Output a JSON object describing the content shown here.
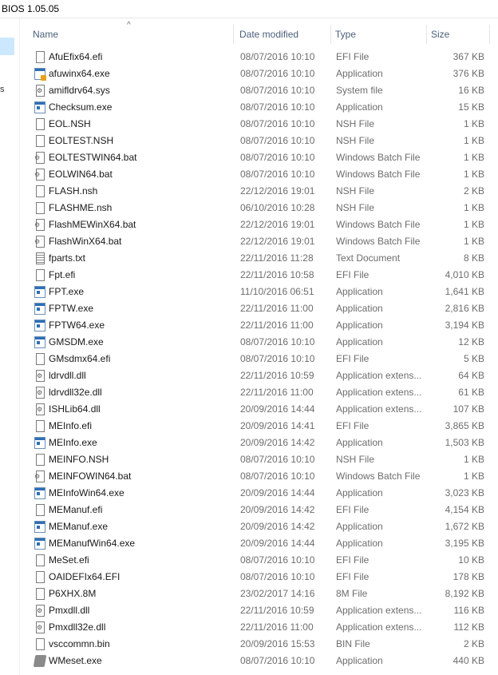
{
  "window": {
    "title": "BIOS 1.05.05"
  },
  "nav": {
    "partial_label": "s"
  },
  "columns": {
    "name": "Name",
    "date": "Date modified",
    "type": "Type",
    "size": "Size",
    "sort_arrow": "^"
  },
  "files": [
    {
      "name": "AfuEfix64.efi",
      "date": "08/07/2016 10:10",
      "type": "EFI File",
      "size": "367 KB",
      "icon": "file-icon"
    },
    {
      "name": "afuwinx64.exe",
      "date": "08/07/2016 10:10",
      "type": "Application",
      "size": "376 KB",
      "icon": "app-shield-icon"
    },
    {
      "name": "amifldrv64.sys",
      "date": "08/07/2016 10:10",
      "type": "System file",
      "size": "16 KB",
      "icon": "system-file-icon"
    },
    {
      "name": "Checksum.exe",
      "date": "08/07/2016 10:10",
      "type": "Application",
      "size": "15 KB",
      "icon": "app-icon"
    },
    {
      "name": "EOL.NSH",
      "date": "08/07/2016 10:10",
      "type": "NSH File",
      "size": "1 KB",
      "icon": "file-icon"
    },
    {
      "name": "EOLTEST.NSH",
      "date": "08/07/2016 10:10",
      "type": "NSH File",
      "size": "1 KB",
      "icon": "file-icon"
    },
    {
      "name": "EOLTESTWIN64.bat",
      "date": "08/07/2016 10:10",
      "type": "Windows Batch File",
      "size": "1 KB",
      "icon": "batch-file-icon"
    },
    {
      "name": "EOLWIN64.bat",
      "date": "08/07/2016 10:10",
      "type": "Windows Batch File",
      "size": "1 KB",
      "icon": "batch-file-icon"
    },
    {
      "name": "FLASH.nsh",
      "date": "22/12/2016 19:01",
      "type": "NSH File",
      "size": "2 KB",
      "icon": "file-icon"
    },
    {
      "name": "FLASHME.nsh",
      "date": "06/10/2016 10:28",
      "type": "NSH File",
      "size": "1 KB",
      "icon": "file-icon"
    },
    {
      "name": "FlashMEWinX64.bat",
      "date": "22/12/2016 19:01",
      "type": "Windows Batch File",
      "size": "1 KB",
      "icon": "batch-file-icon"
    },
    {
      "name": "FlashWinX64.bat",
      "date": "22/12/2016 19:01",
      "type": "Windows Batch File",
      "size": "1 KB",
      "icon": "batch-file-icon"
    },
    {
      "name": "fparts.txt",
      "date": "22/11/2016 11:28",
      "type": "Text Document",
      "size": "8 KB",
      "icon": "text-file-icon"
    },
    {
      "name": "Fpt.efi",
      "date": "22/11/2016 10:58",
      "type": "EFI File",
      "size": "4,010 KB",
      "icon": "file-icon"
    },
    {
      "name": "FPT.exe",
      "date": "11/10/2016 06:51",
      "type": "Application",
      "size": "1,641 KB",
      "icon": "app-icon"
    },
    {
      "name": "FPTW.exe",
      "date": "22/11/2016 11:00",
      "type": "Application",
      "size": "2,816 KB",
      "icon": "app-icon"
    },
    {
      "name": "FPTW64.exe",
      "date": "22/11/2016 11:00",
      "type": "Application",
      "size": "3,194 KB",
      "icon": "app-icon"
    },
    {
      "name": "GMSDM.exe",
      "date": "08/07/2016 10:10",
      "type": "Application",
      "size": "12 KB",
      "icon": "app-icon"
    },
    {
      "name": "GMsdmx64.efi",
      "date": "08/07/2016 10:10",
      "type": "EFI File",
      "size": "5 KB",
      "icon": "file-icon"
    },
    {
      "name": "ldrvdll.dll",
      "date": "22/11/2016 10:59",
      "type": "Application extens...",
      "size": "64 KB",
      "icon": "system-file-icon"
    },
    {
      "name": "ldrvdll32e.dll",
      "date": "22/11/2016 11:00",
      "type": "Application extens...",
      "size": "61 KB",
      "icon": "system-file-icon"
    },
    {
      "name": "ISHLib64.dll",
      "date": "20/09/2016 14:44",
      "type": "Application extens...",
      "size": "107 KB",
      "icon": "system-file-icon"
    },
    {
      "name": "MEInfo.efi",
      "date": "20/09/2016 14:41",
      "type": "EFI File",
      "size": "3,865 KB",
      "icon": "file-icon"
    },
    {
      "name": "MEInfo.exe",
      "date": "20/09/2016 14:42",
      "type": "Application",
      "size": "1,503 KB",
      "icon": "app-icon"
    },
    {
      "name": "MEINFO.NSH",
      "date": "08/07/2016 10:10",
      "type": "NSH File",
      "size": "1 KB",
      "icon": "file-icon"
    },
    {
      "name": "MEINFOWIN64.bat",
      "date": "08/07/2016 10:10",
      "type": "Windows Batch File",
      "size": "1 KB",
      "icon": "batch-file-icon"
    },
    {
      "name": "MEInfoWin64.exe",
      "date": "20/09/2016 14:44",
      "type": "Application",
      "size": "3,023 KB",
      "icon": "app-icon"
    },
    {
      "name": "MEManuf.efi",
      "date": "20/09/2016 14:42",
      "type": "EFI File",
      "size": "4,154 KB",
      "icon": "file-icon"
    },
    {
      "name": "MEManuf.exe",
      "date": "20/09/2016 14:42",
      "type": "Application",
      "size": "1,672 KB",
      "icon": "app-icon"
    },
    {
      "name": "MEManufWin64.exe",
      "date": "20/09/2016 14:44",
      "type": "Application",
      "size": "3,195 KB",
      "icon": "app-icon"
    },
    {
      "name": "MeSet.efi",
      "date": "08/07/2016 10:10",
      "type": "EFI File",
      "size": "10 KB",
      "icon": "file-icon"
    },
    {
      "name": "OAIDEFIx64.EFI",
      "date": "08/07/2016 10:10",
      "type": "EFI File",
      "size": "178 KB",
      "icon": "file-icon"
    },
    {
      "name": "P6XHX.8M",
      "date": "23/02/2017 14:16",
      "type": "8M File",
      "size": "8,192 KB",
      "icon": "file-icon"
    },
    {
      "name": "Pmxdll.dll",
      "date": "22/11/2016 10:59",
      "type": "Application extens...",
      "size": "116 KB",
      "icon": "system-file-icon"
    },
    {
      "name": "Pmxdll32e.dll",
      "date": "22/11/2016 11:00",
      "type": "Application extens...",
      "size": "112 KB",
      "icon": "system-file-icon"
    },
    {
      "name": "vsccommn.bin",
      "date": "20/09/2016 15:53",
      "type": "BIN File",
      "size": "2 KB",
      "icon": "file-icon"
    },
    {
      "name": "WMeset.exe",
      "date": "08/07/2016 10:10",
      "type": "Application",
      "size": "440 KB",
      "icon": "wmeset-app-icon"
    }
  ]
}
